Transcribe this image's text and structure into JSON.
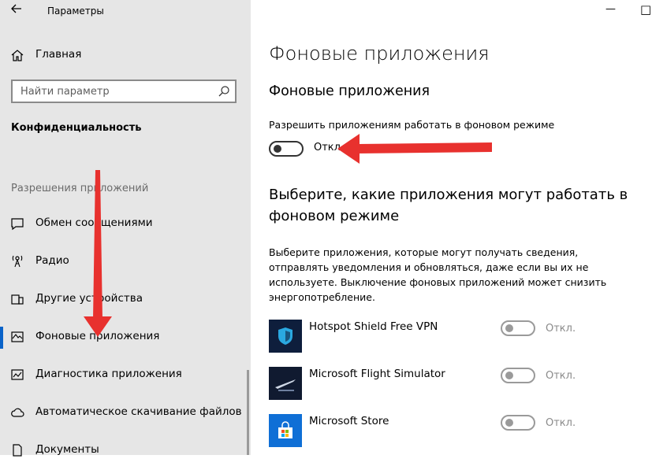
{
  "window": {
    "title": "Параметры",
    "back_icon": "arrow-left-icon",
    "minimize_glyph": "—",
    "maximize_glyph": "□"
  },
  "sidebar": {
    "home_label": "Главная",
    "search_placeholder": "Найти параметр",
    "section_title": "Конфиденциальность",
    "group_header": "Разрешения приложений",
    "items": [
      {
        "label": "Обмен сообщениями",
        "icon": "chat-icon"
      },
      {
        "label": "Радио",
        "icon": "radio-icon"
      },
      {
        "label": "Другие устройства",
        "icon": "devices-icon"
      },
      {
        "label": "Фоновые приложения",
        "icon": "background-apps-icon",
        "selected": true
      },
      {
        "label": "Диагностика приложения",
        "icon": "diagnostics-icon"
      },
      {
        "label": "Автоматическое скачивание файлов",
        "icon": "cloud-icon"
      },
      {
        "label": "Документы",
        "icon": "document-icon"
      }
    ]
  },
  "main": {
    "page_title": "Фоновые приложения",
    "section_title": "Фоновые приложения",
    "allow_label": "Разрешить приложениям работать в фоновом режиме",
    "allow_state": "Откл.",
    "choose_title": "Выберите, какие приложения могут работать в фоновом режиме",
    "choose_desc": "Выберите приложения, которые могут получать сведения, отправлять уведомления и обновляться, даже если вы их не используете. Выключение фоновых приложений может снизить энергопотребление.",
    "apps": [
      {
        "name": "Hotspot Shield Free VPN",
        "state": "Откл."
      },
      {
        "name": "Microsoft Flight Simulator",
        "state": "Откл."
      },
      {
        "name": "Microsoft Store",
        "state": "Откл."
      }
    ]
  },
  "colors": {
    "sidebar_bg": "#e6e6e6",
    "accent": "#0a63c9",
    "annotation_arrow": "#e8312e"
  }
}
